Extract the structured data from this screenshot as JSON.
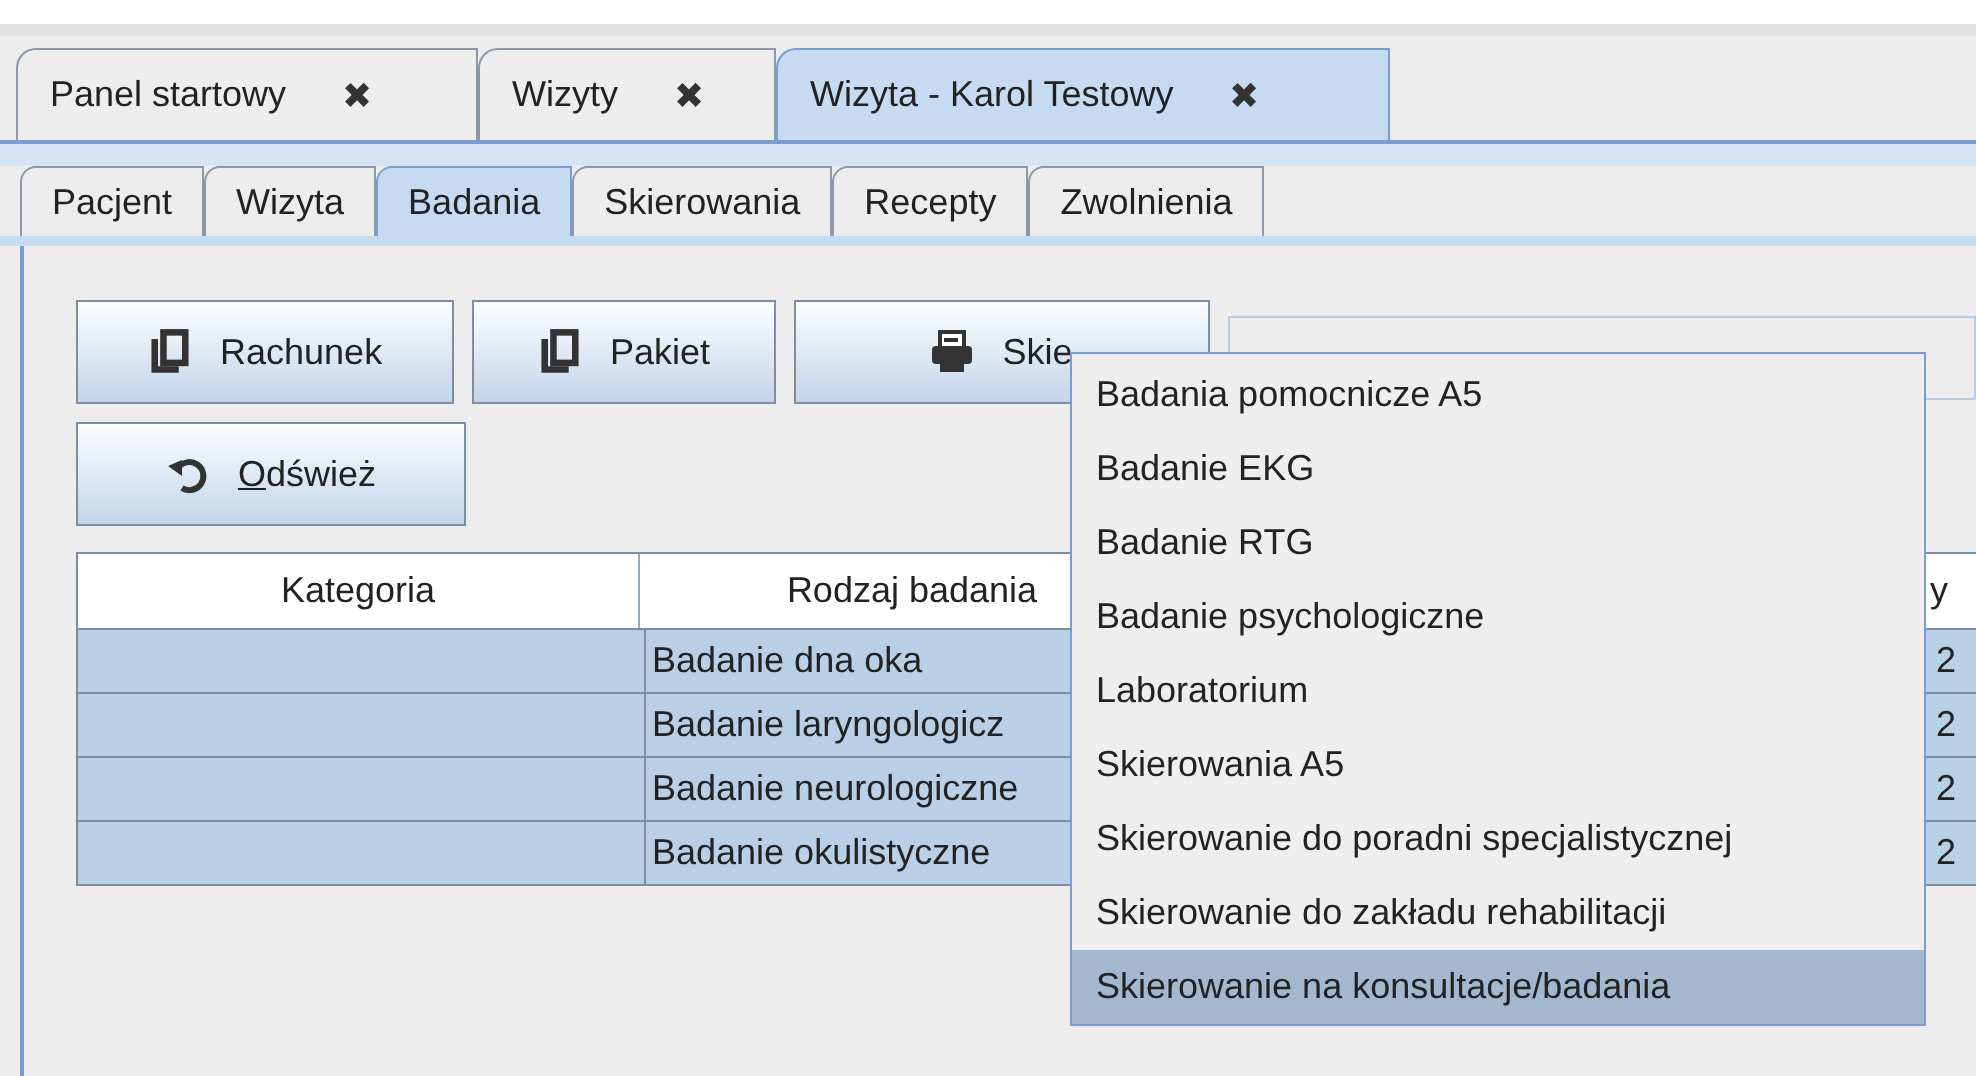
{
  "doc_tabs": [
    {
      "label": "Panel startowy",
      "close": "✖",
      "selected": false
    },
    {
      "label": "Wizyty",
      "close": "✖",
      "selected": false
    },
    {
      "label": "Wizyta - Karol Testowy",
      "close": "✖",
      "selected": true
    }
  ],
  "sub_tabs": [
    {
      "label": "Pacjent",
      "selected": false
    },
    {
      "label": "Wizyta",
      "selected": false
    },
    {
      "label": "Badania",
      "selected": true
    },
    {
      "label": "Skierowania",
      "selected": false
    },
    {
      "label": "Recepty",
      "selected": false
    },
    {
      "label": "Zwolnienia",
      "selected": false
    }
  ],
  "toolbar": {
    "buttons": [
      {
        "label": "Rachunek"
      },
      {
        "label": "Pakiet"
      },
      {
        "label": "Skie"
      }
    ],
    "refresh_button": {
      "mnemonic": "O",
      "rest": "dśwież"
    }
  },
  "table": {
    "columns": [
      "Kategoria",
      "Rodzaj badania",
      "y"
    ],
    "rows": [
      {
        "rodzaj": "Badanie dna oka",
        "column_3": "2",
        "selected": true
      },
      {
        "rodzaj": "Badanie laryngologicz",
        "column_3": "2",
        "selected": true
      },
      {
        "rodzaj": "Badanie neurologiczne",
        "column_3": "2",
        "selected": true
      },
      {
        "rodzaj": "Badanie okulistyczne",
        "column_3": "2",
        "selected": true
      }
    ]
  },
  "popup_menu": {
    "items": [
      {
        "label": "Badania pomocnicze A5",
        "selected": false
      },
      {
        "label": "Badanie EKG",
        "selected": false
      },
      {
        "label": "Badanie RTG",
        "selected": false
      },
      {
        "label": "Badanie psychologiczne",
        "selected": false
      },
      {
        "label": "Laboratorium",
        "selected": false
      },
      {
        "label": "Skierowania A5",
        "selected": false
      },
      {
        "label": "Skierowanie do poradni specjalistycznej",
        "selected": false
      },
      {
        "label": "Skierowanie do zakładu rehabilitacji",
        "selected": false
      },
      {
        "label": "Skierowanie na konsultacje/badania",
        "selected": true
      }
    ]
  }
}
